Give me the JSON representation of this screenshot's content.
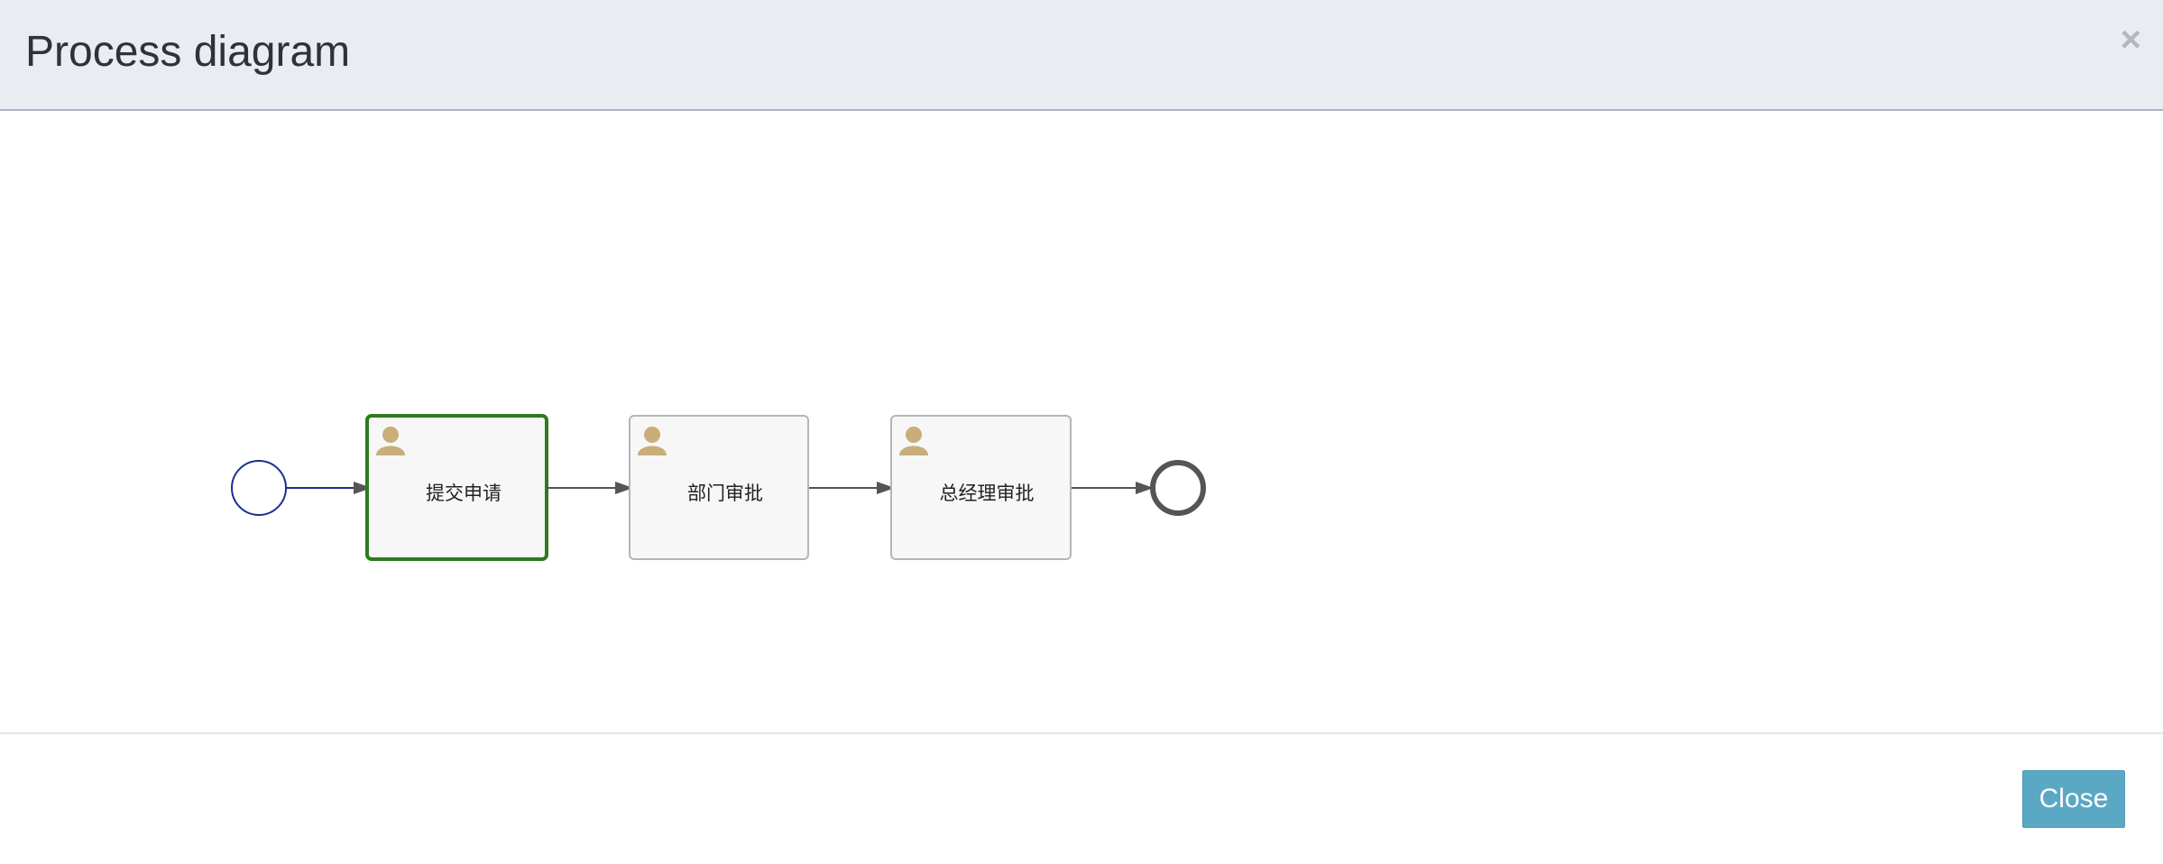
{
  "dialog": {
    "title": "Process diagram",
    "close_icon": "×",
    "close_button_label": "Close"
  },
  "process": {
    "tasks": [
      {
        "label": "提交申请",
        "icon": "user-icon",
        "status": "active"
      },
      {
        "label": "部门审批",
        "icon": "user-icon",
        "status": "pending"
      },
      {
        "label": "总经理审批",
        "icon": "user-icon",
        "status": "pending"
      }
    ],
    "colors": {
      "active_border": "#2e7a1f",
      "pending_border": "#b5b5b5",
      "start_event": "#1a2f8f",
      "end_event": "#555555",
      "flow": "#555555",
      "user_icon": "#c9ae7a",
      "button": "#5ba8c4"
    }
  }
}
